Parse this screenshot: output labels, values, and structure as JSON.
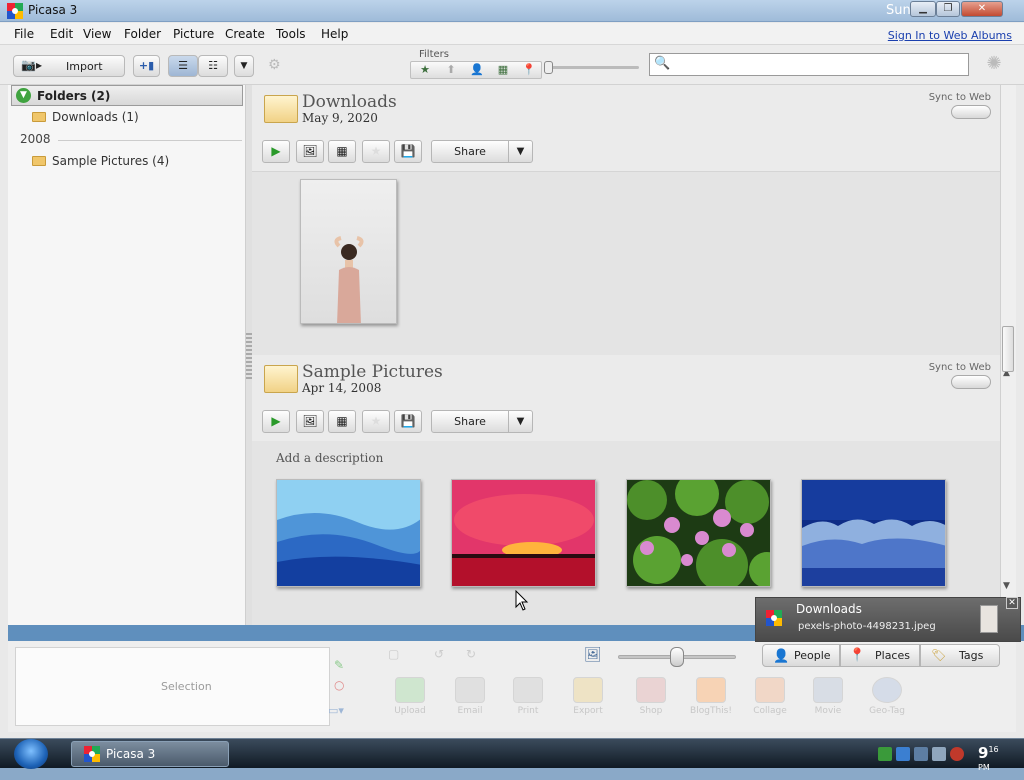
{
  "window": {
    "title": "Picasa 3",
    "clock_partial": "Sun"
  },
  "menu": [
    "File",
    "Edit",
    "View",
    "Folder",
    "Picture",
    "Create",
    "Tools",
    "Help"
  ],
  "signin": "Sign In to Web Albums",
  "toolbar": {
    "import_label": "Import",
    "filters_label": "Filters",
    "search_value": ""
  },
  "sidebar": {
    "header": "Folders (2)",
    "items": [
      {
        "label": "Downloads (1)"
      },
      {
        "year": "2008"
      },
      {
        "label": "Sample Pictures (4)"
      }
    ]
  },
  "sections": [
    {
      "name": "Downloads",
      "date": "May 9, 2020",
      "sync_label": "Sync to Web",
      "share_label": "Share"
    },
    {
      "name": "Sample Pictures",
      "date": "Apr 14, 2008",
      "sync_label": "Sync to Web",
      "share_label": "Share",
      "description_placeholder": "Add a description"
    }
  ],
  "bottom": {
    "selection_label": "Selection",
    "actions": [
      "Upload",
      "Email",
      "Print",
      "Export",
      "Shop",
      "BlogThis!",
      "Collage",
      "Movie",
      "Geo-Tag"
    ],
    "tabs": [
      "People",
      "Places",
      "Tags"
    ]
  },
  "notification": {
    "title": "Downloads",
    "file": "pexels-photo-4498231.jpeg"
  },
  "taskbar": {
    "item": "Picasa 3",
    "clock": "9",
    "clock_min": "16",
    "clock_ampm": "PM"
  },
  "colors": {
    "accent_blue": "#5f8fbd",
    "link": "#1a3fae"
  }
}
